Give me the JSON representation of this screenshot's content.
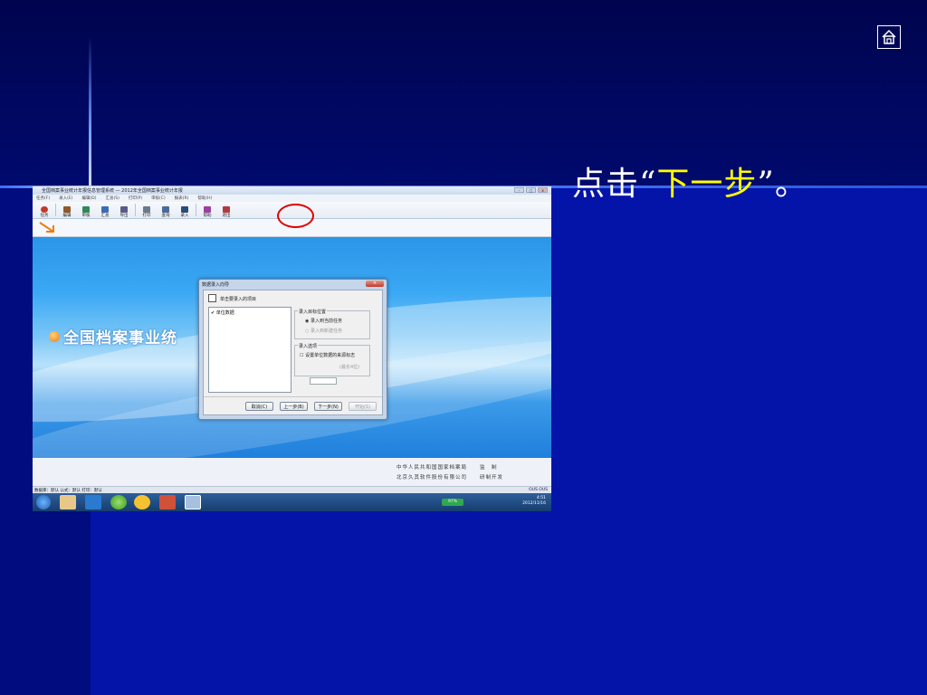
{
  "slide": {
    "caption_prefix": "点击“",
    "caption_highlight": "下一步",
    "caption_suffix": "”。"
  },
  "colors": {
    "highlight": "#ffff00",
    "background": "#0414a8",
    "annotation_circle": "#e00000"
  },
  "app": {
    "window_title": "全国档案事业统计年报信息管理系统 — 2012年全国档案事业统计年报",
    "menu": [
      "任务(F)",
      "录入(E)",
      "编辑(D)",
      "汇总(S)",
      "打印(P)",
      "审核(C)",
      "报表(R)",
      "帮助(H)"
    ],
    "toolbar": [
      "任务",
      "编辑",
      "审核",
      "汇总",
      "导出",
      "打印",
      "查询",
      "录入",
      "帮助",
      "退出"
    ],
    "banner_title": "全国档案事业统",
    "footer_line1_left": "中华人民共和国国家档案局",
    "footer_line1_right": "监　制",
    "footer_line2_left": "北京久其软件股份有限公司",
    "footer_line2_right": "研制开发",
    "status_left": "数据库：默认  公式：默认  打印：默认",
    "status_right": "OUS  OUS",
    "taskbar_battery": "97%",
    "clock_time": "4:51",
    "clock_date": "2012/11/16"
  },
  "dialog": {
    "title": "数据录入向导",
    "close_label": "×",
    "header": "单击要录入的项目",
    "list_items": [
      "✔ 单位数据"
    ],
    "group_target": {
      "title": "录入目标位置",
      "option1": "◉ 录入到当前任务",
      "option2": "○ 录入到新建任务"
    },
    "group_options": {
      "title": "录入选项",
      "checkbox": "☐ 设置单位数据的来源标志",
      "field_label": "(最长4位)"
    },
    "buttons": {
      "cancel": "取消(C)",
      "prev": "上一步(B)",
      "next": "下一步(N)",
      "start": "开始(S)"
    }
  }
}
